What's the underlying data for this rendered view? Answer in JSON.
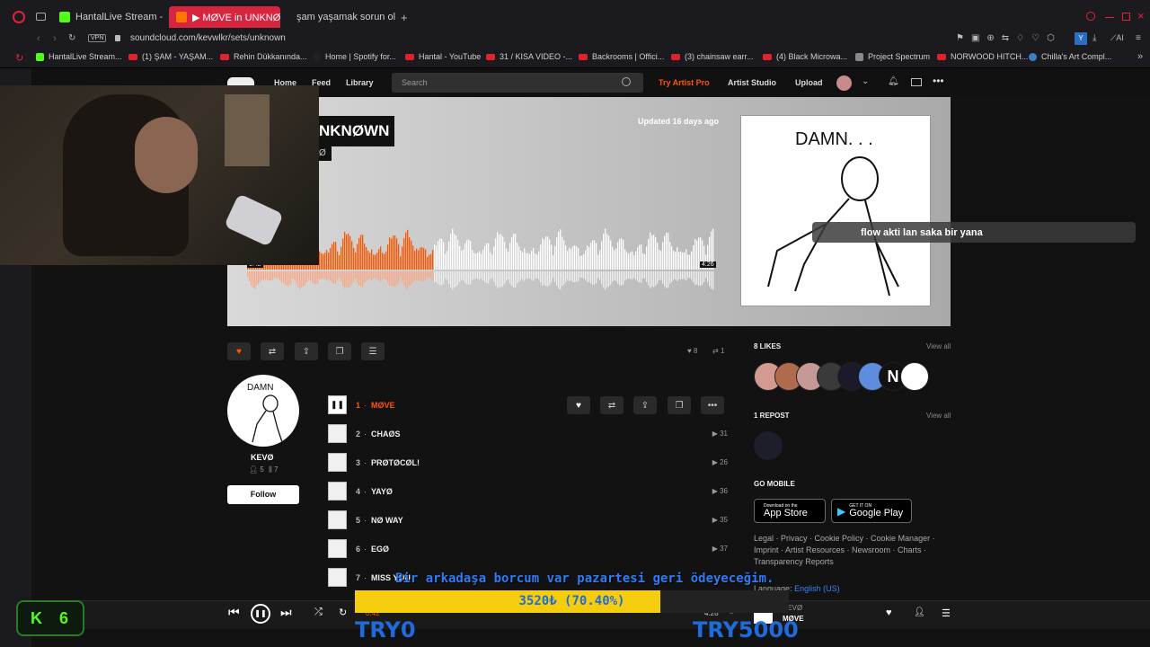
{
  "tabs": [
    {
      "label": "HantalLive Stream - Watch"
    },
    {
      "label": "▶ MØVE in UNKNØWN"
    },
    {
      "label": "şam yaşamak sorun oldu i"
    }
  ],
  "address": {
    "vpn": "VPN",
    "url": "soundcloud.com/kevwlkr/sets/unknown"
  },
  "bookmarks": [
    "HantalLive Stream...",
    "(1) ŞAM - YAŞAM...",
    "Rehin Dükkanında...",
    "Home | Spotify for...",
    "Hantal - YouTube",
    "31 / KISA VIDEO -...",
    "Backrooms | Offici...",
    "(3) chainsaw earr...",
    "(4) Black Microwa...",
    "Project Spectrum",
    "NORWOOD HITCH...",
    "Chilla's Art Compl..."
  ],
  "header": {
    "home": "Home",
    "feed": "Feed",
    "library": "Library",
    "search_placeholder": "Search",
    "try_pro": "Try Artist Pro",
    "artist_studio": "Artist Studio",
    "upload": "Upload"
  },
  "hero": {
    "title": "NKNØWN",
    "subtitle": "Ø",
    "updated": "Updated 16 days ago",
    "time_start": "0:42",
    "time_end": "4:26",
    "progress": 0.4
  },
  "chat_overlay": {
    "user": "",
    "message": "flow akti lan saka bir yana"
  },
  "actions": {
    "likes": "8",
    "reposts": "1"
  },
  "artist": {
    "name": "KEVØ",
    "followers": "5",
    "tracks": "7",
    "follow": "Follow"
  },
  "tracks": [
    {
      "num": "1",
      "title": "MØVE",
      "plays": ""
    },
    {
      "num": "2",
      "title": "CHAØS",
      "plays": "31"
    },
    {
      "num": "3",
      "title": "PRØTØCØL!",
      "plays": "26"
    },
    {
      "num": "4",
      "title": "YAYØ",
      "plays": "36"
    },
    {
      "num": "5",
      "title": "NØ WAY",
      "plays": "35"
    },
    {
      "num": "6",
      "title": "EGØ",
      "plays": "37"
    },
    {
      "num": "7",
      "title": "MISS YØU",
      "plays": ""
    }
  ],
  "right": {
    "likes_head": "8 LIKES",
    "reposts_head": "1 REPOST",
    "view_all": "View all",
    "mobile_head": "GO MOBILE",
    "app_store_small": "Download on the",
    "app_store_big": "App Store",
    "play_small": "GET IT ON",
    "play_big": "Google Play",
    "footer1": "Legal · Privacy · Cookie Policy · Cookie Manager ·",
    "footer2": "Imprint · Artist Resources · Newsroom · Charts ·",
    "footer3": "Transparency Reports",
    "language_label": "Language:",
    "language_value": "English (US)"
  },
  "stream": {
    "kick_count": "6",
    "donation_text": "Bir arkadaşa borcum var pazartesi geri ödeyeceğim.",
    "goal_text": "3520₺ (70.40%)",
    "goal_fraction": 0.704,
    "left_label": "TRY0",
    "right_label": "TRY5000"
  },
  "player": {
    "elapsed": "0:42",
    "duration": "4:26",
    "artist": "KEVØ",
    "track": "MØVE"
  },
  "colors": {
    "accent": "#ff5500",
    "tab_active": "#d8253f",
    "goal_bar": "#f5cd0c",
    "goal_text": "#1e6cdb",
    "kick": "#53fc18"
  }
}
